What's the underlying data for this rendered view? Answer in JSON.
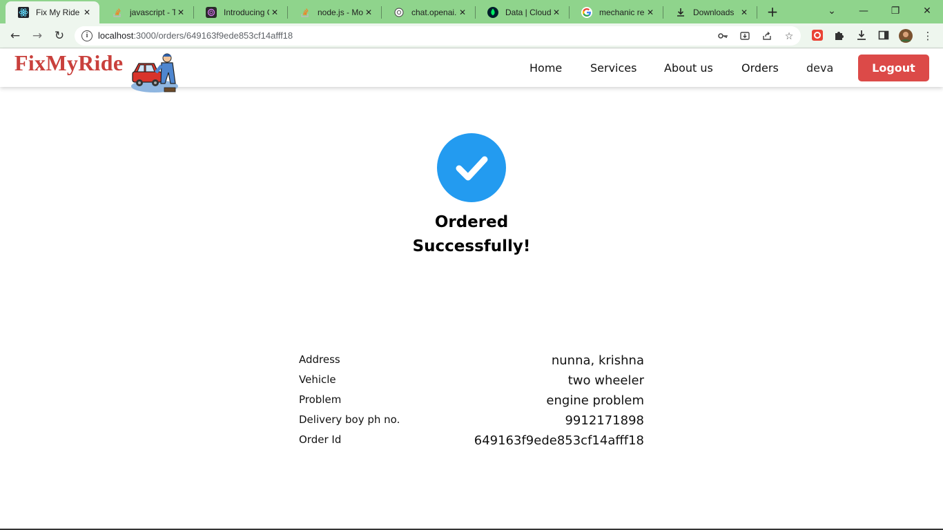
{
  "browser": {
    "tabs": [
      {
        "title": "Fix My Ride",
        "icon": "react-icon",
        "active": true
      },
      {
        "title": "javascript - Ty",
        "icon": "stackoverflow-icon",
        "active": false
      },
      {
        "title": "Introducing C",
        "icon": "openai-icon",
        "active": false
      },
      {
        "title": "node.js - Mor",
        "icon": "stackoverflow-icon",
        "active": false
      },
      {
        "title": "chat.openai.c",
        "icon": "openai-icon",
        "active": false
      },
      {
        "title": "Data | Cloud",
        "icon": "mongodb-icon",
        "active": false
      },
      {
        "title": "mechanic real",
        "icon": "google-icon",
        "active": false
      },
      {
        "title": "Downloads",
        "icon": "download-icon",
        "active": false
      }
    ],
    "url_host": "localhost",
    "url_path": ":3000/orders/649163f9ede853cf14afff18"
  },
  "site": {
    "logo": "FixMyRide",
    "nav": {
      "home": "Home",
      "services": "Services",
      "about": "About us",
      "orders": "Orders",
      "user": "deva",
      "logout": "Logout"
    }
  },
  "confirmation": {
    "title_line1": "Ordered",
    "title_line2": "Successfully!"
  },
  "details": [
    {
      "label": "Address",
      "value": "nunna, krishna"
    },
    {
      "label": "Vehicle",
      "value": "two wheeler"
    },
    {
      "label": "Problem",
      "value": "engine problem"
    },
    {
      "label": "Delivery boy ph no.",
      "value": "9912171898"
    },
    {
      "label": "Order Id",
      "value": "649163f9ede853cf14afff18"
    }
  ],
  "colors": {
    "tabstrip": "#8fd48c",
    "accent_blue": "#239bf0",
    "logout_red": "#dc4a48",
    "logo_red": "#c9403c"
  }
}
